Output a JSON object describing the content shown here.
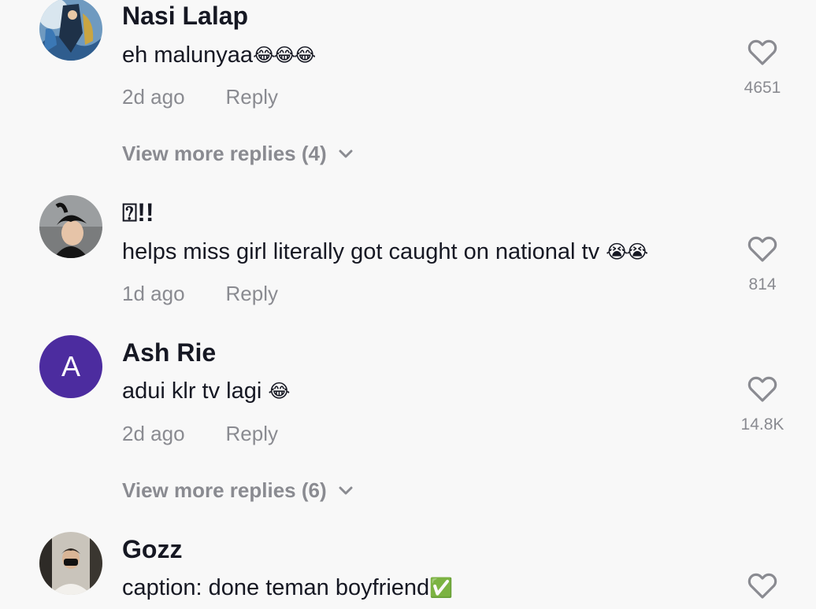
{
  "comments": [
    {
      "username": "Nasi Lalap",
      "text": "eh malunyaa",
      "emoji": "😂😂😂",
      "time": "2d ago",
      "reply": "Reply",
      "likes": "4651",
      "more_replies": "View more replies (4)",
      "avatar_icon": "anime-figure-avatar"
    },
    {
      "username": "⍰!!",
      "text": "helps miss girl literally got caught on national tv ",
      "emoji": "😭😭",
      "time": "1d ago",
      "reply": "Reply",
      "likes": "814",
      "avatar_icon": "person-photo-avatar"
    },
    {
      "username": "Ash Rie",
      "text": "adui klr tv lagi ",
      "emoji": "😂",
      "time": "2d ago",
      "reply": "Reply",
      "likes": "14.8K",
      "more_replies": "View more replies (6)",
      "avatar_letter": "A",
      "avatar_color": "#4c2c9f"
    },
    {
      "username": "Gozz",
      "text": "caption: done teman boyfriend",
      "emoji": "✅",
      "avatar_icon": "mirror-selfie-avatar"
    }
  ],
  "colors": {
    "background": "#f8f8f8",
    "primary_text": "#161823",
    "secondary_text": "#8a8b91",
    "heart_stroke": "#8a8b91"
  }
}
